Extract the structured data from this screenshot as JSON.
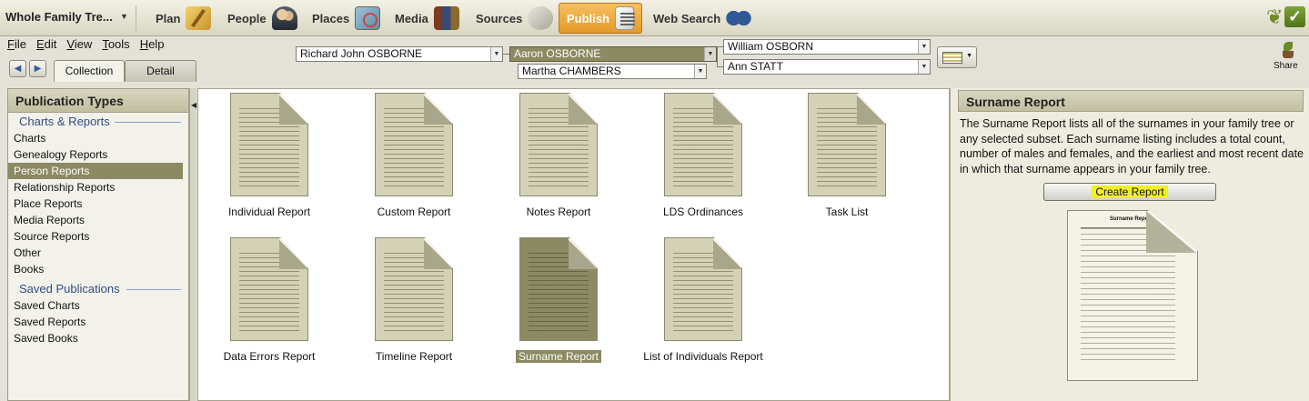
{
  "topbar": {
    "tree_name": "Whole Family Tre...",
    "nav": [
      {
        "label": "Plan",
        "icon": "plan-icon"
      },
      {
        "label": "People",
        "icon": "people-icon"
      },
      {
        "label": "Places",
        "icon": "places-icon"
      },
      {
        "label": "Media",
        "icon": "media-icon"
      },
      {
        "label": "Sources",
        "icon": "sources-icon"
      },
      {
        "label": "Publish",
        "icon": "publish-icon",
        "active": true
      },
      {
        "label": "Web Search",
        "icon": "web-search-icon"
      }
    ]
  },
  "menu": [
    "File",
    "Edit",
    "View",
    "Tools",
    "Help"
  ],
  "tabs": {
    "collection": "Collection",
    "detail": "Detail"
  },
  "family": {
    "person": "Richard John OSBORNE",
    "father": "Aaron OSBORNE",
    "mother": "Martha CHAMBERS",
    "grandfather": "William OSBORN",
    "grandmother": "Ann STATT"
  },
  "share_label": "Share",
  "left_panel": {
    "title": "Publication Types",
    "charts_group": "Charts & Reports",
    "charts_items": [
      "Charts",
      "Genealogy Reports",
      "Person Reports",
      "Relationship Reports",
      "Place Reports",
      "Media Reports",
      "Source Reports",
      "Other",
      "Books"
    ],
    "selected_item": "Person Reports",
    "saved_group": "Saved Publications",
    "saved_items": [
      "Saved Charts",
      "Saved Reports",
      "Saved Books"
    ]
  },
  "reports": [
    {
      "label": "Individual Report"
    },
    {
      "label": "Custom Report"
    },
    {
      "label": "Notes Report"
    },
    {
      "label": "LDS Ordinances"
    },
    {
      "label": "Task List"
    },
    {
      "label": "Data Errors Report"
    },
    {
      "label": "Timeline Report"
    },
    {
      "label": "Surname Report",
      "selected": true
    },
    {
      "label": "List of Individuals Report"
    }
  ],
  "right_panel": {
    "title": "Surname Report",
    "description": "The Surname Report lists all of the surnames in your family tree or any selected subset.  Each surname listing includes a total count, number of males and females, and the earliest and most recent date in which that surname appears in your family tree.",
    "button": "Create Report",
    "preview_title": "Surname Report"
  },
  "colors": {
    "selected": "#8b8a62",
    "accent": "#e39a28",
    "button_highlight": "#f0f02a"
  }
}
